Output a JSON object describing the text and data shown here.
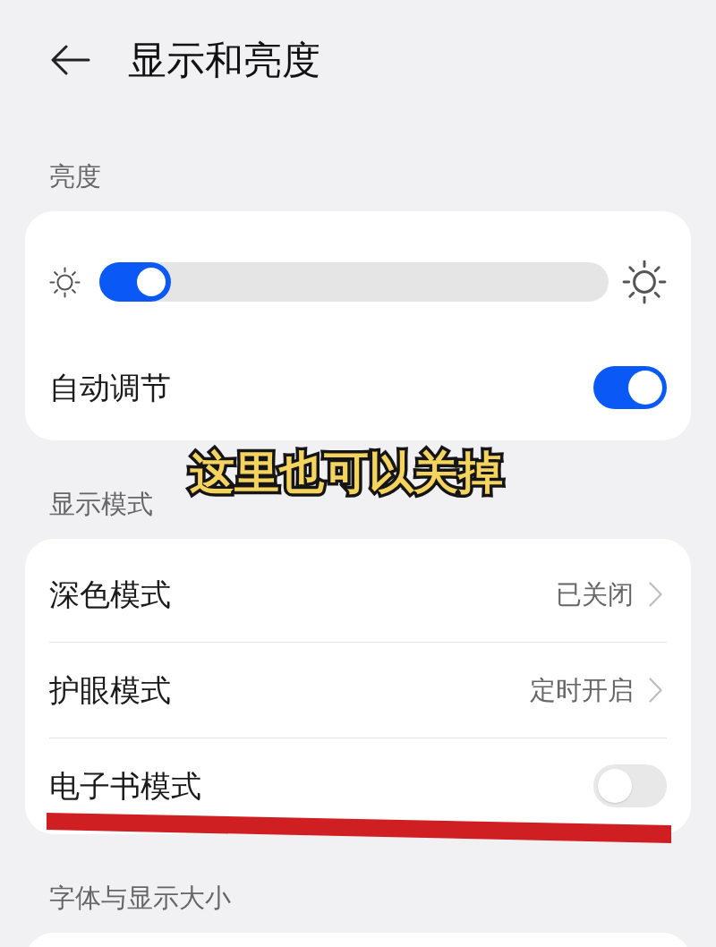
{
  "header": {
    "title": "显示和亮度"
  },
  "sections": [
    {
      "label": "亮度",
      "items": [
        {
          "kind": "slider",
          "level": 0.14
        },
        {
          "kind": "switch",
          "label": "自动调节",
          "on": true
        }
      ]
    },
    {
      "label": "显示模式",
      "items": [
        {
          "kind": "link",
          "label": "深色模式",
          "value": "已关闭"
        },
        {
          "kind": "link",
          "label": "护眼模式",
          "value": "定时开启"
        },
        {
          "kind": "switch",
          "label": "电子书模式",
          "on": false
        }
      ]
    },
    {
      "label": "字体与显示大小"
    }
  ],
  "annotation": {
    "text": "这里也可以关掉"
  }
}
